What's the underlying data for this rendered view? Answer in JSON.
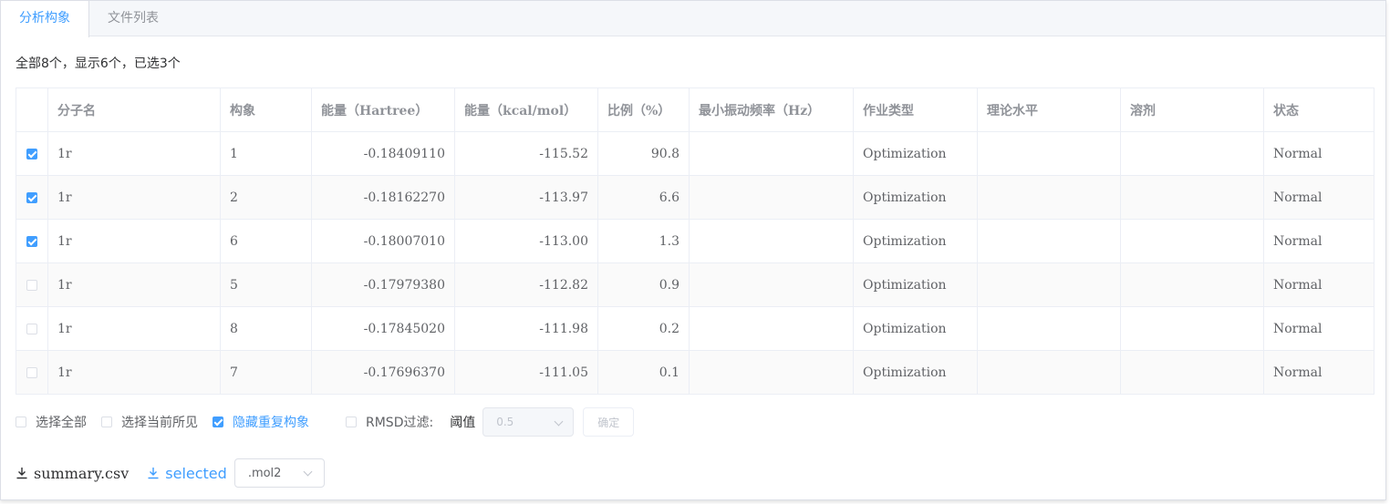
{
  "tabs": [
    {
      "label": "分析构象",
      "active": true
    },
    {
      "label": "文件列表",
      "active": false
    }
  ],
  "summary_text": "全部8个，显示6个，已选3个",
  "table": {
    "headers": [
      "分子名",
      "构象",
      "能量（Hartree）",
      "能量（kcal/mol）",
      "比例（%）",
      "最小振动频率（Hz）",
      "作业类型",
      "理论水平",
      "溶剂",
      "状态"
    ],
    "rows": [
      {
        "checked": true,
        "cells": [
          "1r",
          "1",
          "-0.18409110",
          "-115.52",
          "90.8",
          "",
          "Optimization",
          "",
          "",
          "Normal"
        ]
      },
      {
        "checked": true,
        "cells": [
          "1r",
          "2",
          "-0.18162270",
          "-113.97",
          "6.6",
          "",
          "Optimization",
          "",
          "",
          "Normal"
        ]
      },
      {
        "checked": true,
        "cells": [
          "1r",
          "6",
          "-0.18007010",
          "-113.00",
          "1.3",
          "",
          "Optimization",
          "",
          "",
          "Normal"
        ]
      },
      {
        "checked": false,
        "cells": [
          "1r",
          "5",
          "-0.17979380",
          "-112.82",
          "0.9",
          "",
          "Optimization",
          "",
          "",
          "Normal"
        ]
      },
      {
        "checked": false,
        "cells": [
          "1r",
          "8",
          "-0.17845020",
          "-111.98",
          "0.2",
          "",
          "Optimization",
          "",
          "",
          "Normal"
        ]
      },
      {
        "checked": false,
        "cells": [
          "1r",
          "7",
          "-0.17696370",
          "-111.05",
          "0.1",
          "",
          "Optimization",
          "",
          "",
          "Normal"
        ]
      }
    ]
  },
  "controls": {
    "select_all": "选择全部",
    "select_visible": "选择当前所见",
    "hide_duplicates": "隐藏重复构象",
    "rmsd_filter": "RMSD过滤:",
    "threshold_label": "阈值",
    "threshold_value": "0.5",
    "confirm": "确定"
  },
  "downloads": {
    "summary": "summary.csv",
    "selected": "selected",
    "format": ".mol2"
  },
  "colors": {
    "accent": "#409eff",
    "border": "#ebeef5",
    "header_text": "#909399"
  }
}
